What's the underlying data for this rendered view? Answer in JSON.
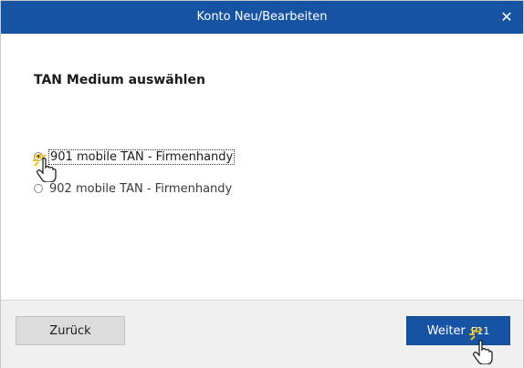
{
  "window": {
    "title": "Konto Neu/Bearbeiten",
    "close_glyph": "✕"
  },
  "main": {
    "heading": "TAN Medium auswählen",
    "options": [
      {
        "label": "901 mobile TAN - Firmenhandy",
        "selected": true
      },
      {
        "label": "902 mobile TAN - Firmenhandy",
        "selected": false
      }
    ]
  },
  "footer": {
    "back_label": "Zurück",
    "next_label": "Weiter",
    "next_shortcut": "F11"
  },
  "colors": {
    "titlebar": "#1753a3",
    "primary_button": "#1753a3",
    "footer_bg": "#f0f0f0",
    "click_highlight": "#f2c200"
  },
  "icons": {
    "close": "close-icon",
    "cursor": "hand-pointer-icon"
  }
}
